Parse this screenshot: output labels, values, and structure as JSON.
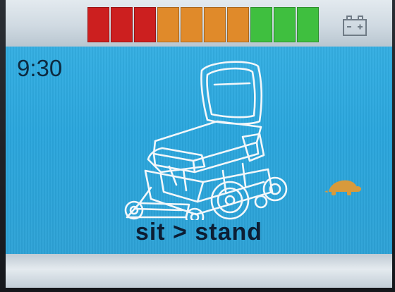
{
  "status_bar": {
    "battery_level_segments": 10,
    "segment_colors": [
      "#cc1f1f",
      "#cc1f1f",
      "#cc1f1f",
      "#e08a2a",
      "#e08a2a",
      "#e08a2a",
      "#e08a2a",
      "#3fbf3f",
      "#3fbf3f",
      "#3fbf3f"
    ],
    "battery_icon": "battery-icon"
  },
  "main": {
    "time": "9:30",
    "mode": "sit > stand",
    "chair_icon": "power-wheelchair-icon",
    "speed_icon": "turtle-icon",
    "background_color": "#2ea8de"
  }
}
